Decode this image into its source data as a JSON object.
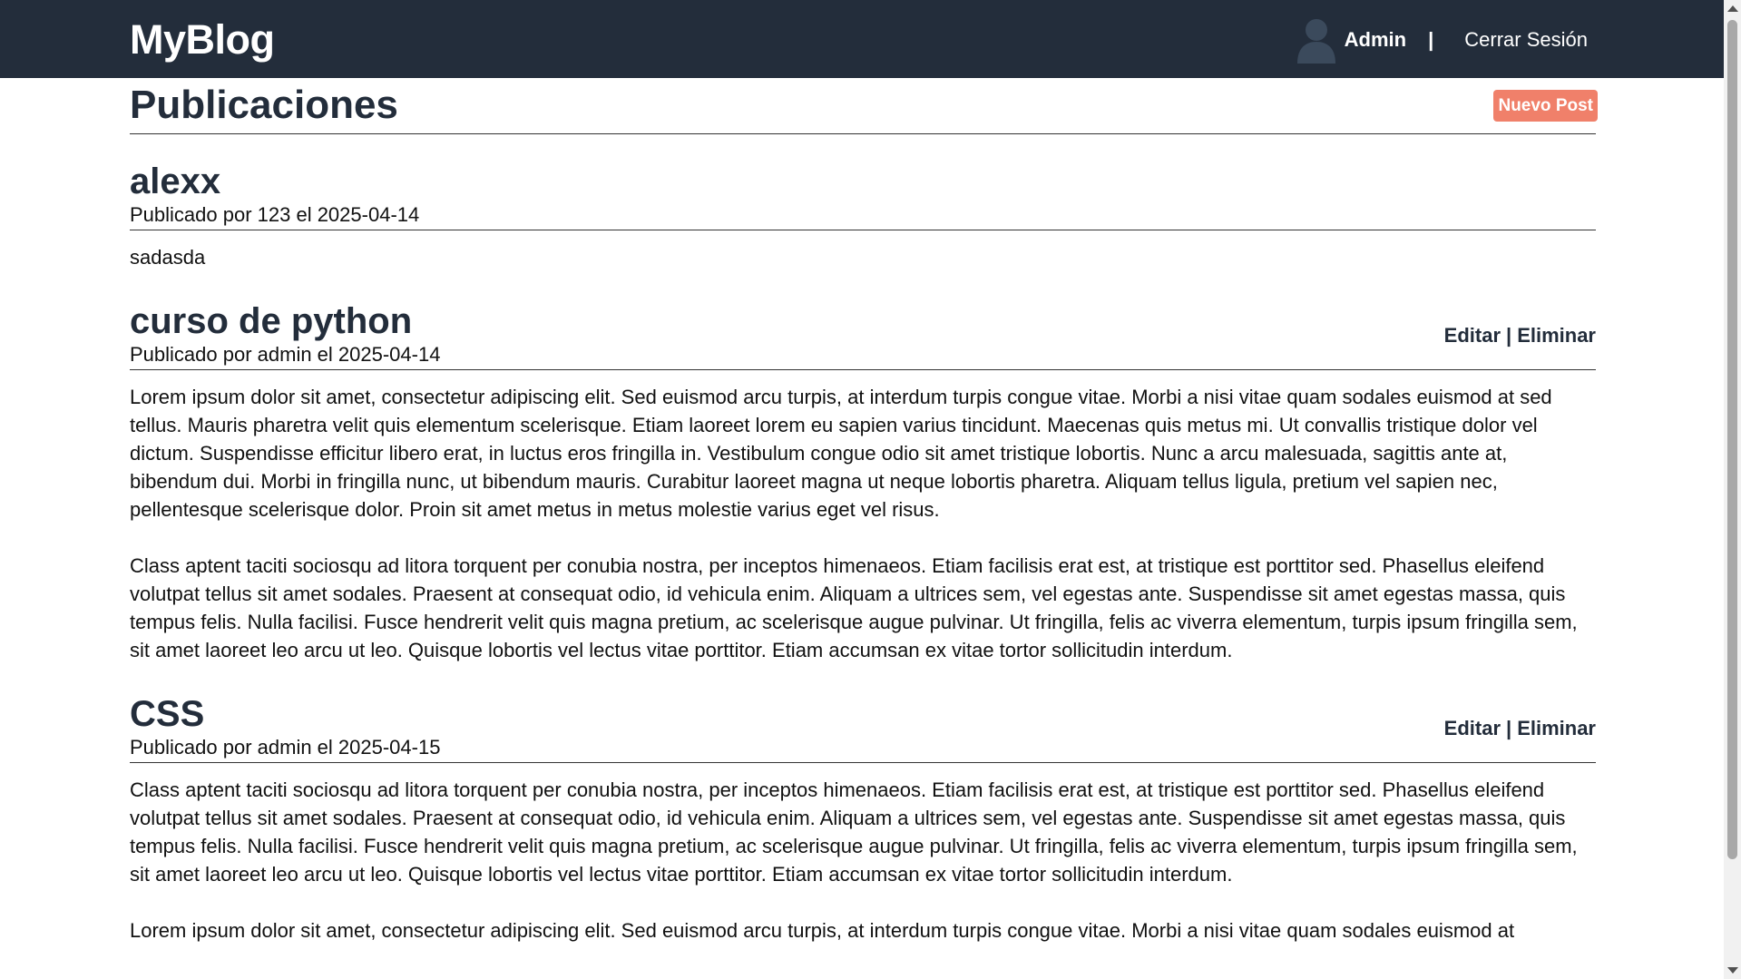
{
  "navbar": {
    "brand": "MyBlog",
    "user": "Admin",
    "separator": "|",
    "logout": "Cerrar Sesión"
  },
  "page": {
    "title": "Publicaciones",
    "new_post_label": "Nuevo Post"
  },
  "posts": [
    {
      "title": "alexx",
      "meta": "Publicado por 123 el 2025-04-14",
      "paragraphs": [
        "sadasda"
      ]
    },
    {
      "title": "curso de python",
      "meta": "Publicado por admin el 2025-04-14",
      "edit_label": "Editar",
      "actions_sep": "|",
      "delete_label": "Eliminar",
      "paragraphs": [
        "Lorem ipsum dolor sit amet, consectetur adipiscing elit. Sed euismod arcu turpis, at interdum turpis congue vitae. Morbi a nisi vitae quam sodales euismod at sed tellus. Mauris pharetra velit quis elementum scelerisque. Etiam laoreet lorem eu sapien varius tincidunt. Maecenas quis metus mi. Ut convallis tristique dolor vel dictum. Suspendisse efficitur libero erat, in luctus eros fringilla in. Vestibulum congue odio sit amet tristique lobortis. Nunc a arcu malesuada, sagittis ante at, bibendum dui. Morbi in fringilla nunc, ut bibendum mauris. Curabitur laoreet magna ut neque lobortis pharetra. Aliquam tellus ligula, pretium vel sapien nec, pellentesque scelerisque dolor. Proin sit amet metus in metus molestie varius eget vel risus.",
        "Class aptent taciti sociosqu ad litora torquent per conubia nostra, per inceptos himenaeos. Etiam facilisis erat est, at tristique est porttitor sed. Phasellus eleifend volutpat tellus sit amet sodales. Praesent at consequat odio, id vehicula enim. Aliquam a ultrices sem, vel egestas ante. Suspendisse sit amet egestas massa, quis tempus felis. Nulla facilisi. Fusce hendrerit velit quis magna pretium, ac scelerisque augue pulvinar. Ut fringilla, felis ac viverra elementum, turpis ipsum fringilla sem, sit amet laoreet leo arcu ut leo. Quisque lobortis vel lectus vitae porttitor. Etiam accumsan ex vitae tortor sollicitudin interdum."
      ]
    },
    {
      "title": "CSS",
      "meta": "Publicado por admin el 2025-04-15",
      "edit_label": "Editar",
      "actions_sep": "|",
      "delete_label": "Eliminar",
      "paragraphs": [
        "Class aptent taciti sociosqu ad litora torquent per conubia nostra, per inceptos himenaeos. Etiam facilisis erat est, at tristique est porttitor sed. Phasellus eleifend volutpat tellus sit amet sodales. Praesent at consequat odio, id vehicula enim. Aliquam a ultrices sem, vel egestas ante. Suspendisse sit amet egestas massa, quis tempus felis. Nulla facilisi. Fusce hendrerit velit quis magna pretium, ac scelerisque augue pulvinar. Ut fringilla, felis ac viverra elementum, turpis ipsum fringilla sem, sit amet laoreet leo arcu ut leo. Quisque lobortis vel lectus vitae porttitor. Etiam accumsan ex vitae tortor sollicitudin interdum.",
        "Lorem ipsum dolor sit amet, consectetur adipiscing elit. Sed euismod arcu turpis, at interdum turpis congue vitae. Morbi a nisi vitae quam sodales euismod at"
      ]
    }
  ],
  "icons": {
    "avatar": "user-silhouette-icon"
  },
  "colors": {
    "navbar_bg": "#232d3b",
    "accent": "#f0806a",
    "heading": "#232d3b"
  }
}
